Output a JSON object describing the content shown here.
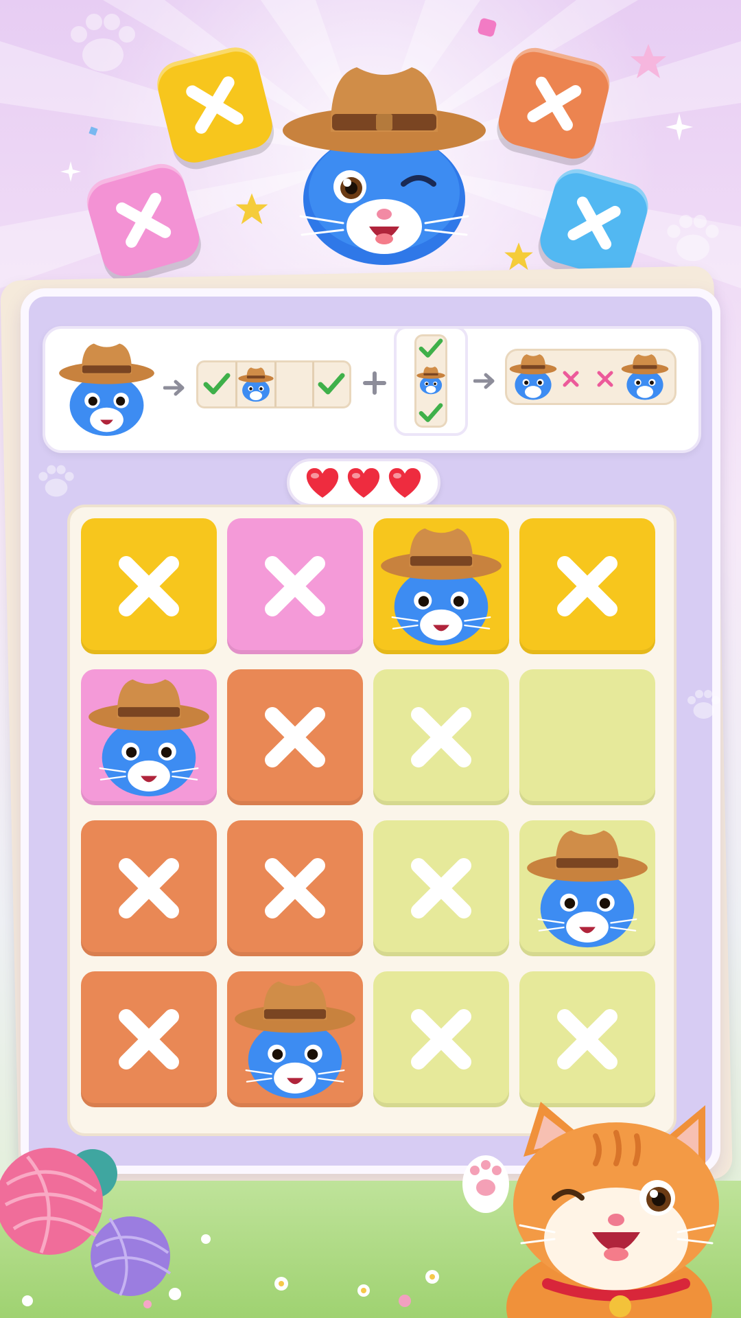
{
  "colors": {
    "yellow": "#f7c61d",
    "pink": "#f49ad8",
    "orange": "#e98855",
    "lime": "#e6e99a",
    "blue": "#52b8f2",
    "heart": "#ee2c3f",
    "check": "#3fb04a",
    "cross": "#ec5a9a"
  },
  "hud": {
    "lives": 3,
    "hearts": [
      "heart",
      "heart",
      "heart"
    ]
  },
  "rule_panel": {
    "steps": [
      "cat-token",
      "arrow",
      "row-example",
      "plus",
      "column-example",
      "arrow",
      "no-adjacent-example"
    ]
  },
  "board": {
    "rows": 4,
    "cols": 4,
    "cells": [
      [
        {
          "color": "yellow",
          "mark": "x"
        },
        {
          "color": "pink",
          "mark": "x"
        },
        {
          "color": "yellow",
          "mark": "cat"
        },
        {
          "color": "yellow",
          "mark": "x"
        }
      ],
      [
        {
          "color": "pink",
          "mark": "cat"
        },
        {
          "color": "orange",
          "mark": "x"
        },
        {
          "color": "lime",
          "mark": "x"
        },
        {
          "color": "lime",
          "mark": "empty"
        }
      ],
      [
        {
          "color": "orange",
          "mark": "x"
        },
        {
          "color": "orange",
          "mark": "x"
        },
        {
          "color": "lime",
          "mark": "x"
        },
        {
          "color": "lime",
          "mark": "cat"
        }
      ],
      [
        {
          "color": "orange",
          "mark": "x"
        },
        {
          "color": "orange",
          "mark": "cat"
        },
        {
          "color": "lime",
          "mark": "x"
        },
        {
          "color": "lime",
          "mark": "x"
        }
      ]
    ]
  },
  "decor": {
    "floating_tiles": [
      "yellow",
      "orange",
      "pink",
      "blue"
    ],
    "mascot": "blue-cowboy-cat",
    "corner_mascot": "orange-cat-waving",
    "yarn_balls": [
      "pink",
      "purple",
      "teal"
    ]
  }
}
